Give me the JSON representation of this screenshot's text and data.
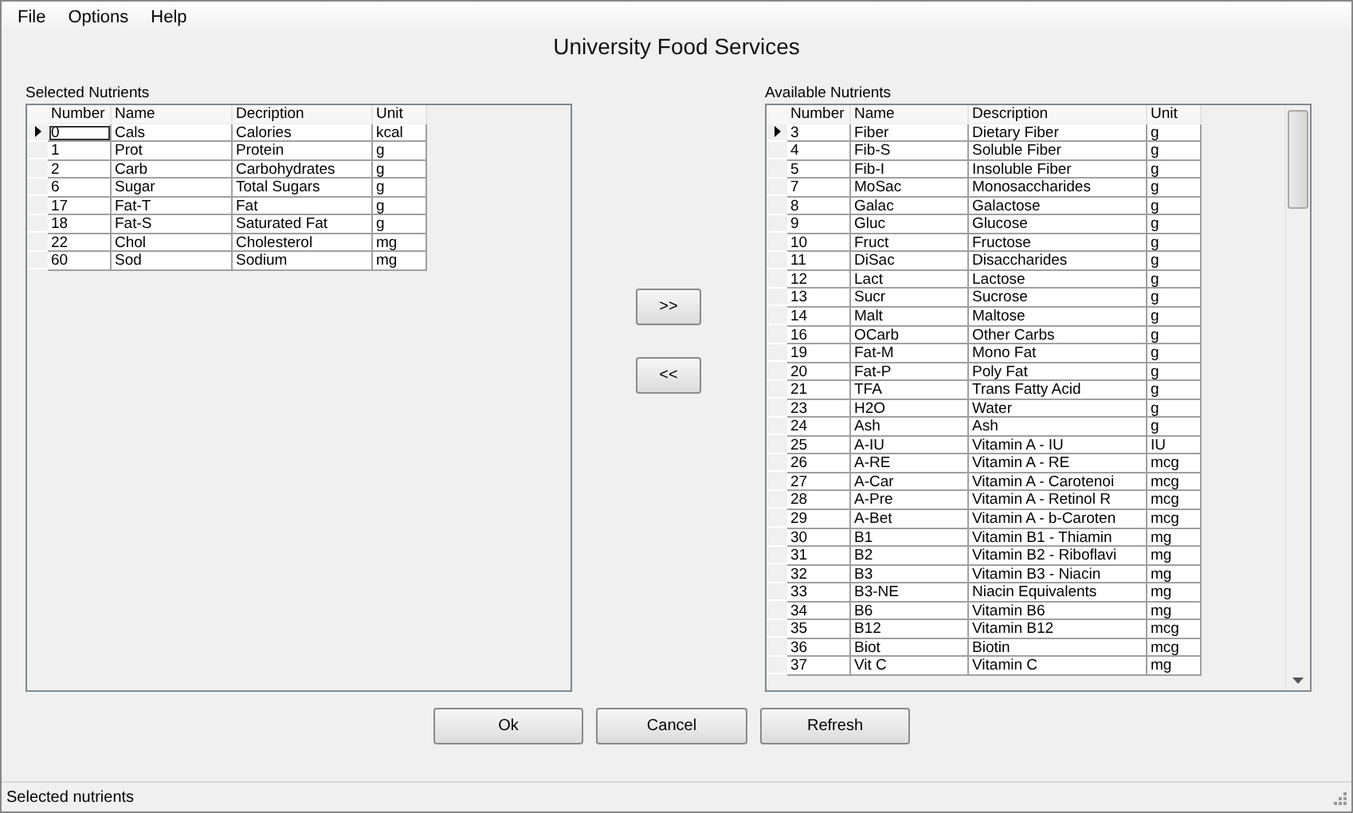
{
  "menu": [
    "File",
    "Options",
    "Help"
  ],
  "title": "University Food Services",
  "selected_nutrients": {
    "label": "Selected Nutrients",
    "focused": true,
    "columns": [
      "Number",
      "Name",
      "Decription",
      "Unit"
    ],
    "rows": [
      {
        "number": "0",
        "name": "Cals",
        "description": "Calories",
        "unit": "kcal",
        "current": true
      },
      {
        "number": "1",
        "name": "Prot",
        "description": "Protein",
        "unit": "g",
        "current": false
      },
      {
        "number": "2",
        "name": "Carb",
        "description": "Carbohydrates",
        "unit": "g",
        "current": false
      },
      {
        "number": "6",
        "name": "Sugar",
        "description": "Total Sugars",
        "unit": "g",
        "current": false
      },
      {
        "number": "17",
        "name": "Fat-T",
        "description": "Fat",
        "unit": "g",
        "current": false
      },
      {
        "number": "18",
        "name": "Fat-S",
        "description": "Saturated Fat",
        "unit": "g",
        "current": false
      },
      {
        "number": "22",
        "name": "Chol",
        "description": "Cholesterol",
        "unit": "mg",
        "current": false
      },
      {
        "number": "60",
        "name": "Sod",
        "description": "Sodium",
        "unit": "mg",
        "current": false
      }
    ]
  },
  "move_buttons": [
    ">>",
    "<<"
  ],
  "available_nutrients": {
    "label": "Available Nutrients",
    "focused": false,
    "columns": [
      "Number",
      "Name",
      "Description",
      "Unit"
    ],
    "rows": [
      {
        "number": "3",
        "name": "Fiber",
        "description": "Dietary Fiber",
        "unit": "g",
        "current": true
      },
      {
        "number": "4",
        "name": "Fib-S",
        "description": "Soluble Fiber",
        "unit": "g",
        "current": false
      },
      {
        "number": "5",
        "name": "Fib-I",
        "description": "Insoluble Fiber",
        "unit": "g",
        "current": false
      },
      {
        "number": "7",
        "name": "MoSac",
        "description": "Monosaccharides",
        "unit": "g",
        "current": false
      },
      {
        "number": "8",
        "name": "Galac",
        "description": "Galactose",
        "unit": "g",
        "current": false
      },
      {
        "number": "9",
        "name": "Gluc",
        "description": "Glucose",
        "unit": "g",
        "current": false
      },
      {
        "number": "10",
        "name": "Fruct",
        "description": "Fructose",
        "unit": "g",
        "current": false
      },
      {
        "number": "11",
        "name": "DiSac",
        "description": "Disaccharides",
        "unit": "g",
        "current": false
      },
      {
        "number": "12",
        "name": "Lact",
        "description": "Lactose",
        "unit": "g",
        "current": false
      },
      {
        "number": "13",
        "name": "Sucr",
        "description": "Sucrose",
        "unit": "g",
        "current": false
      },
      {
        "number": "14",
        "name": "Malt",
        "description": "Maltose",
        "unit": "g",
        "current": false
      },
      {
        "number": "16",
        "name": "OCarb",
        "description": "Other Carbs",
        "unit": "g",
        "current": false
      },
      {
        "number": "19",
        "name": "Fat-M",
        "description": "Mono Fat",
        "unit": "g",
        "current": false
      },
      {
        "number": "20",
        "name": "Fat-P",
        "description": "Poly Fat",
        "unit": "g",
        "current": false
      },
      {
        "number": "21",
        "name": "TFA",
        "description": "Trans Fatty Acid",
        "unit": "g",
        "current": false
      },
      {
        "number": "23",
        "name": "H2O",
        "description": "Water",
        "unit": "g",
        "current": false
      },
      {
        "number": "24",
        "name": "Ash",
        "description": "Ash",
        "unit": "g",
        "current": false
      },
      {
        "number": "25",
        "name": "A-IU",
        "description": "Vitamin A - IU",
        "unit": "IU",
        "current": false
      },
      {
        "number": "26",
        "name": "A-RE",
        "description": "Vitamin A - RE",
        "unit": "mcg",
        "current": false
      },
      {
        "number": "27",
        "name": "A-Car",
        "description": "Vitamin A - Carotenoi",
        "unit": "mcg",
        "current": false
      },
      {
        "number": "28",
        "name": "A-Pre",
        "description": "Vitamin A - Retinol R",
        "unit": "mcg",
        "current": false
      },
      {
        "number": "29",
        "name": "A-Bet",
        "description": "Vitamin A - b-Caroten",
        "unit": "mcg",
        "current": false
      },
      {
        "number": "30",
        "name": "B1",
        "description": "Vitamin B1 - Thiamin",
        "unit": "mg",
        "current": false
      },
      {
        "number": "31",
        "name": "B2",
        "description": "Vitamin B2 - Riboflavi",
        "unit": "mg",
        "current": false
      },
      {
        "number": "32",
        "name": "B3",
        "description": "Vitamin B3 - Niacin",
        "unit": "mg",
        "current": false
      },
      {
        "number": "33",
        "name": "B3-NE",
        "description": "Niacin Equivalents",
        "unit": "mg",
        "current": false
      },
      {
        "number": "34",
        "name": "B6",
        "description": "Vitamin B6",
        "unit": "mg",
        "current": false
      },
      {
        "number": "35",
        "name": "B12",
        "description": "Vitamin B12",
        "unit": "mcg",
        "current": false
      },
      {
        "number": "36",
        "name": "Biot",
        "description": "Biotin",
        "unit": "mcg",
        "current": false
      },
      {
        "number": "37",
        "name": "Vit C",
        "description": "Vitamin C",
        "unit": "mg",
        "current": false
      }
    ]
  },
  "buttons": [
    "Ok",
    "Cancel",
    "Refresh"
  ],
  "status_bar": "Selected nutrients"
}
